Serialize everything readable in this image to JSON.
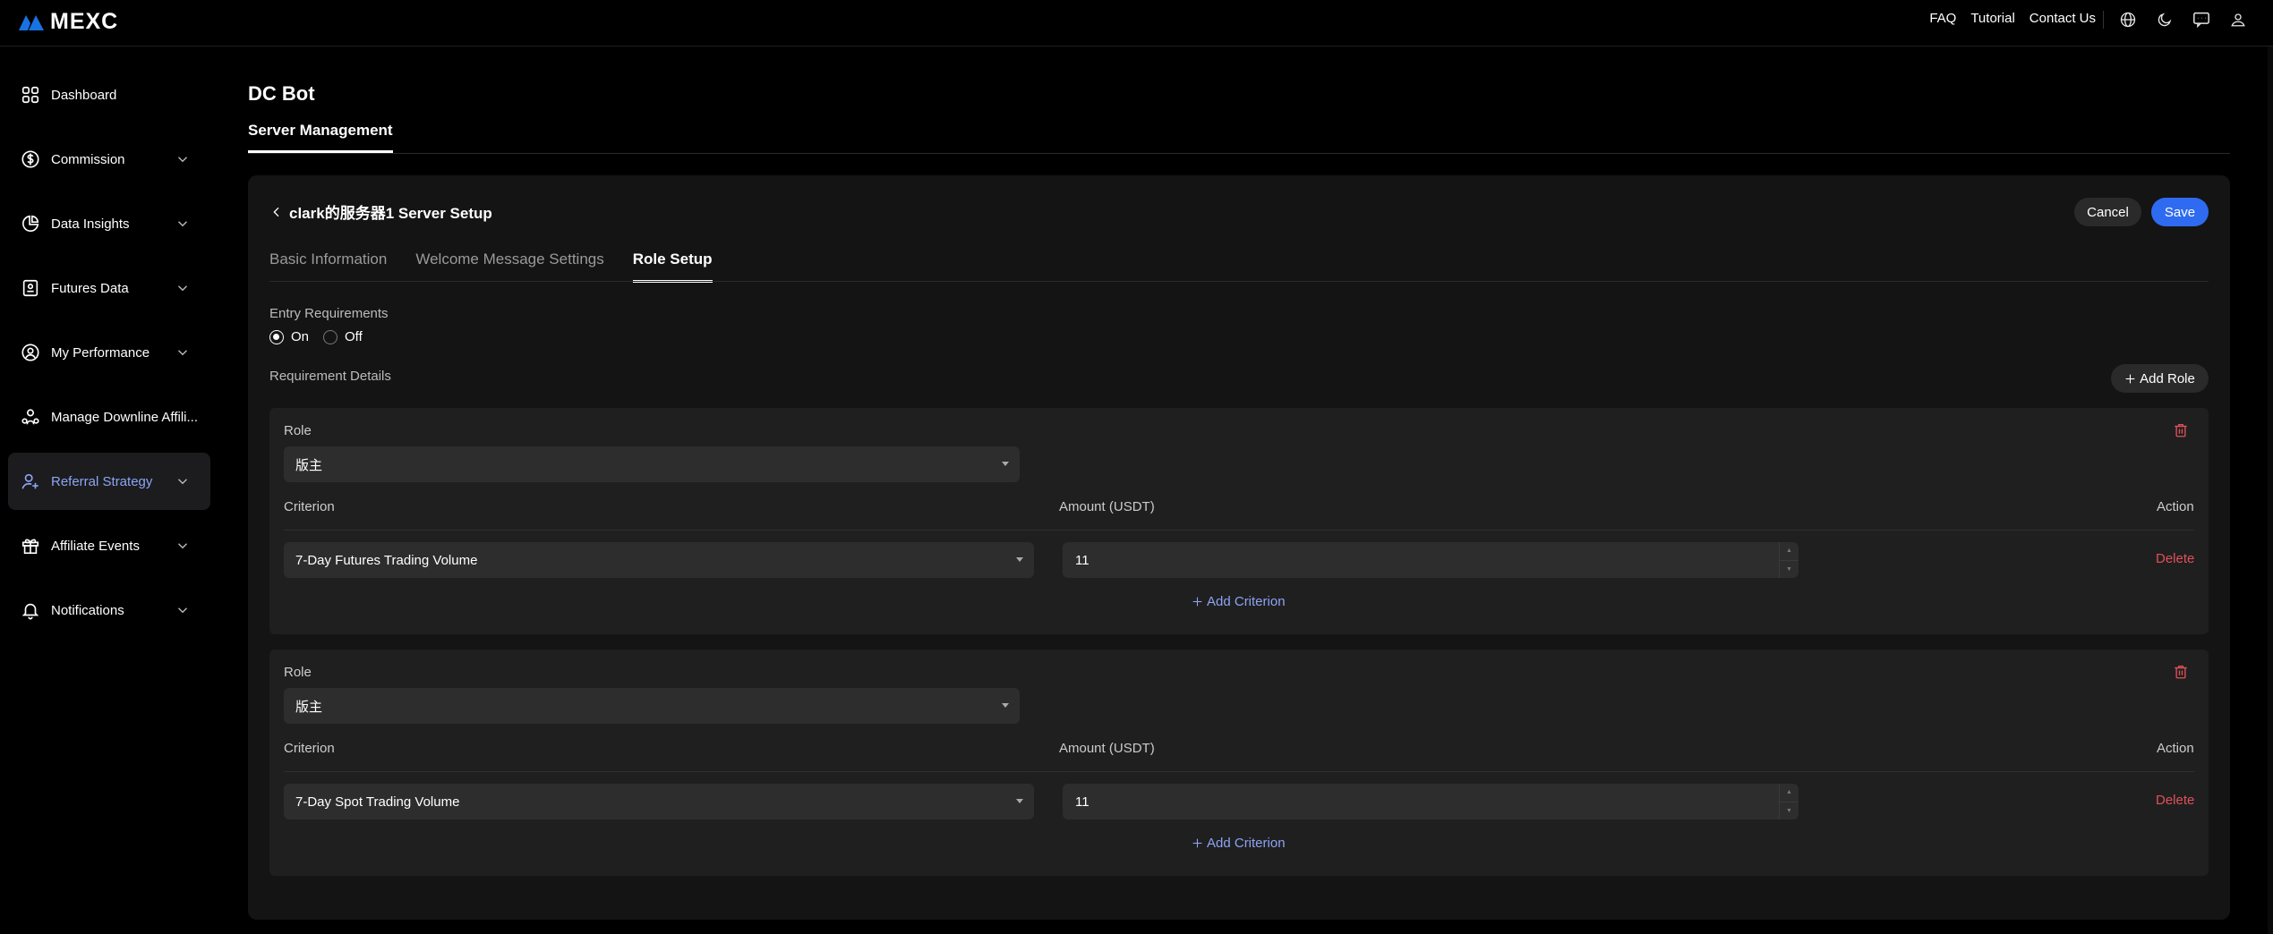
{
  "brand": {
    "name": "MEXC",
    "color": "#1972e2"
  },
  "header": {
    "links": [
      "FAQ",
      "Tutorial",
      "Contact Us"
    ],
    "icons": [
      "globe-icon",
      "moon-icon",
      "chat-icon",
      "user-icon"
    ]
  },
  "sidebar": {
    "items": [
      {
        "label": "Dashboard",
        "icon": "grid-icon",
        "expandable": false
      },
      {
        "label": "Commission",
        "icon": "dollar-circle-icon",
        "expandable": true
      },
      {
        "label": "Data Insights",
        "icon": "pie-chart-icon",
        "expandable": true
      },
      {
        "label": "Futures Data",
        "icon": "document-icon",
        "expandable": true
      },
      {
        "label": "My Performance",
        "icon": "person-badge-icon",
        "expandable": true
      },
      {
        "label": "Manage Downline Affili...",
        "icon": "team-icon",
        "expandable": false
      },
      {
        "label": "Referral Strategy",
        "icon": "user-add-icon",
        "expandable": true,
        "active": true
      },
      {
        "label": "Affiliate Events",
        "icon": "gift-icon",
        "expandable": true
      },
      {
        "label": "Notifications",
        "icon": "bell-icon",
        "expandable": true
      }
    ]
  },
  "main": {
    "title": "DC Bot",
    "tab": "Server Management",
    "panel": {
      "title": "clark的服务器1 Server Setup",
      "cancel_label": "Cancel",
      "save_label": "Save",
      "tabs": [
        "Basic Information",
        "Welcome Message Settings",
        "Role Setup"
      ],
      "active_tab": "Role Setup",
      "entry_requirements_label": "Entry Requirements",
      "radio_on": "On",
      "radio_off": "Off",
      "entry_requirements_value": "On",
      "requirement_details_label": "Requirement Details",
      "add_role_label": "Add Role",
      "roles": [
        {
          "role_label": "Role",
          "role_value": "版主",
          "criterion_header": "Criterion",
          "amount_header": "Amount (USDT)",
          "action_header": "Action",
          "criterion_value": "7-Day Futures Trading Volume",
          "amount_value": "11",
          "delete_label": "Delete",
          "add_criterion_label": "Add Criterion"
        },
        {
          "role_label": "Role",
          "role_value": "版主",
          "criterion_header": "Criterion",
          "amount_header": "Amount (USDT)",
          "action_header": "Action",
          "criterion_value": "7-Day Spot Trading Volume",
          "amount_value": "11",
          "delete_label": "Delete",
          "add_criterion_label": "Add Criterion"
        }
      ]
    }
  },
  "colors": {
    "accent": "#2f6bf1",
    "active_nav": "#8da4f5",
    "danger": "#e0505a"
  }
}
